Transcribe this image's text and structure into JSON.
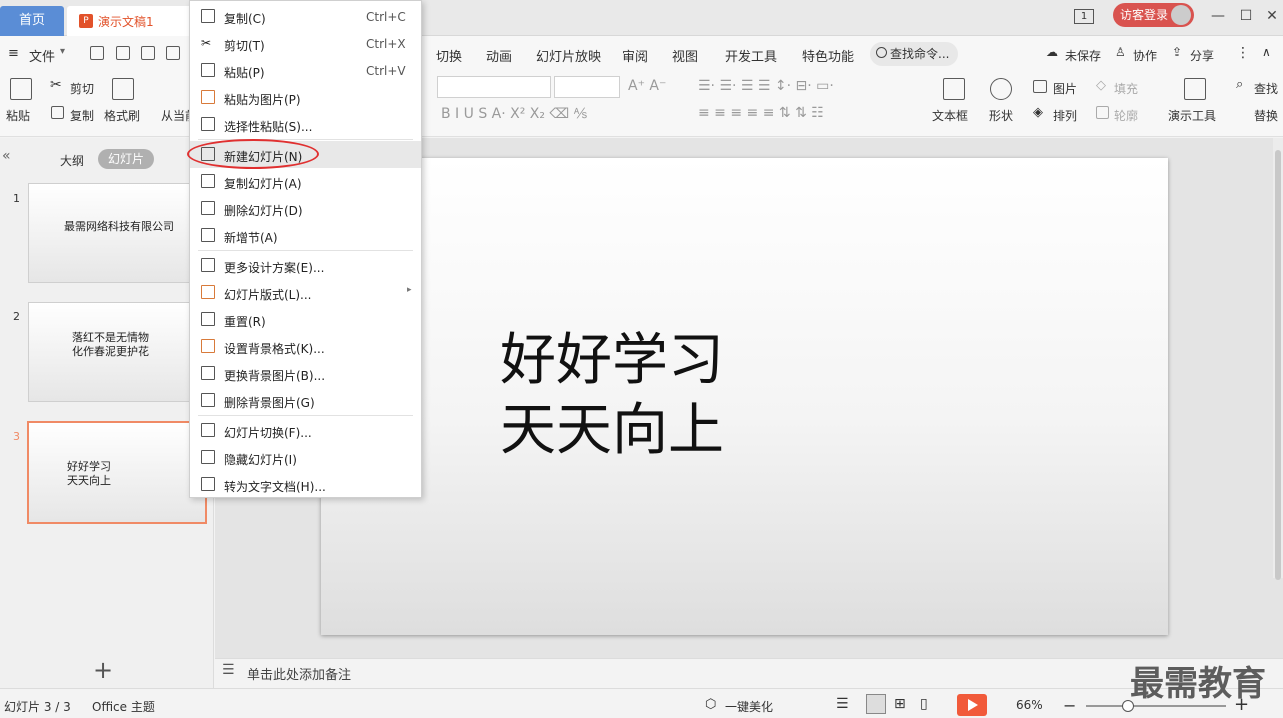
{
  "titlebar": {
    "home_tab": "首页",
    "doc_tab": "演示文稿1",
    "doc_icon": "P",
    "window_badge": "1",
    "login": "访客登录",
    "minimize": "—",
    "maximize": "☐",
    "close": "✕"
  },
  "menubar": {
    "file": "文件",
    "tabs": [
      "切换",
      "动画",
      "幻灯片放映",
      "审阅",
      "视图",
      "开发工具",
      "特色功能"
    ],
    "search": "查找命令...",
    "unsaved": "未保存",
    "collab": "协作",
    "share": "分享"
  },
  "ribbon": {
    "paste": "粘贴",
    "cut": "剪切",
    "copy": "复制",
    "format_painter": "格式刷",
    "from_current": "从当前",
    "textbox": "文本框",
    "shape": "形状",
    "picture": "图片",
    "fill": "填充",
    "arrange": "排列",
    "outline": "轮廓",
    "present_tools": "演示工具",
    "find": "查找",
    "replace": "替换"
  },
  "panel": {
    "outline_tab": "大纲",
    "slides_tab": "幻灯片",
    "add": "+"
  },
  "slides": [
    {
      "num": "1",
      "text": "最需网络科技有限公司"
    },
    {
      "num": "2",
      "text_line1": "落红不是无情物",
      "text_line2": "化作春泥更护花"
    },
    {
      "num": "3",
      "text_line1": "好好学习",
      "text_line2": "天天向上"
    }
  ],
  "canvas": {
    "line1": "好好学习",
    "line2": "天天向上",
    "notes": "单击此处添加备注"
  },
  "context_menu": {
    "items": [
      {
        "label": "复制(C)",
        "shortcut": "Ctrl+C",
        "icon": "copy-icon"
      },
      {
        "label": "剪切(T)",
        "shortcut": "Ctrl+X",
        "icon": "scissors-icon"
      },
      {
        "label": "粘贴(P)",
        "shortcut": "Ctrl+V",
        "icon": "paste-icon"
      },
      {
        "label": "粘贴为图片(P)",
        "icon": "paste-image-icon"
      },
      {
        "label": "选择性粘贴(S)...",
        "icon": "paste-special-icon"
      },
      {
        "label": "新建幻灯片(N)",
        "icon": "new-slide-icon"
      },
      {
        "label": "复制幻灯片(A)",
        "icon": "duplicate-slide-icon"
      },
      {
        "label": "删除幻灯片(D)",
        "icon": "delete-slide-icon"
      },
      {
        "label": "新增节(A)",
        "icon": "new-section-icon"
      },
      {
        "label": "更多设计方案(E)...",
        "icon": "design-icon"
      },
      {
        "label": "幻灯片版式(L)...",
        "icon": "layout-icon"
      },
      {
        "label": "重置(R)",
        "icon": "reset-icon"
      },
      {
        "label": "设置背景格式(K)...",
        "icon": "background-format-icon"
      },
      {
        "label": "更换背景图片(B)...",
        "icon": "change-background-icon"
      },
      {
        "label": "删除背景图片(G)",
        "icon": "delete-background-icon"
      },
      {
        "label": "幻灯片切换(F)...",
        "icon": "transition-icon"
      },
      {
        "label": "隐藏幻灯片(I)",
        "icon": "hide-slide-icon"
      },
      {
        "label": "转为文字文档(H)...",
        "icon": "convert-doc-icon"
      }
    ]
  },
  "statusbar": {
    "slide_count": "幻灯片 3 / 3",
    "theme": "Office 主题",
    "beautify": "一键美化",
    "zoom": "66%",
    "minus": "−",
    "plus": "+"
  },
  "watermark": "最需教育"
}
